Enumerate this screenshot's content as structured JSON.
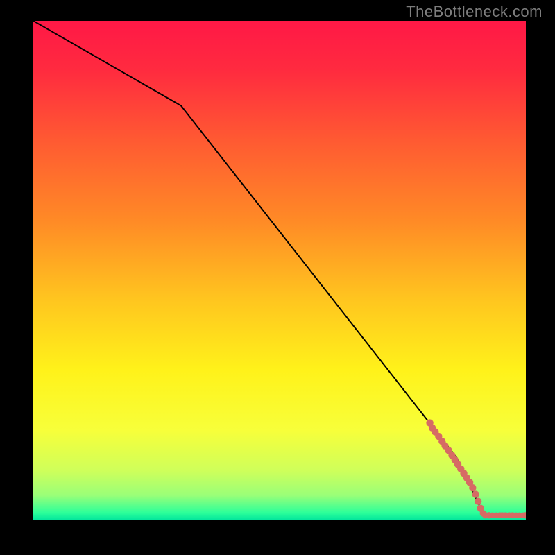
{
  "watermark": "TheBottleneck.com",
  "colors": {
    "background": "#000000",
    "gradient_stops": [
      {
        "offset": 0.0,
        "color": "#ff1846"
      },
      {
        "offset": 0.1,
        "color": "#ff2b3f"
      },
      {
        "offset": 0.24,
        "color": "#ff5a32"
      },
      {
        "offset": 0.4,
        "color": "#ff8a26"
      },
      {
        "offset": 0.56,
        "color": "#ffc61f"
      },
      {
        "offset": 0.7,
        "color": "#fff21a"
      },
      {
        "offset": 0.82,
        "color": "#f7ff3a"
      },
      {
        "offset": 0.9,
        "color": "#cfff5a"
      },
      {
        "offset": 0.95,
        "color": "#9aff78"
      },
      {
        "offset": 0.985,
        "color": "#2cff9a"
      },
      {
        "offset": 1.0,
        "color": "#00e39c"
      }
    ],
    "curve": "#000000",
    "markers": "#d66a64"
  },
  "chart_data": {
    "type": "line",
    "title": "",
    "xlabel": "",
    "ylabel": "",
    "xlim": [
      0,
      100
    ],
    "ylim": [
      0,
      100
    ],
    "grid": false,
    "series": [
      {
        "name": "curve",
        "x": [
          0,
          30,
          86,
          91.5,
          100
        ],
        "y": [
          100,
          83,
          12.5,
          1,
          1
        ]
      }
    ],
    "markers": [
      {
        "x": 80.5,
        "y": 19.5,
        "r": 1.0
      },
      {
        "x": 81.0,
        "y": 18.5,
        "r": 1.0
      },
      {
        "x": 81.6,
        "y": 17.7,
        "r": 1.0
      },
      {
        "x": 82.3,
        "y": 16.8,
        "r": 1.0
      },
      {
        "x": 83.0,
        "y": 15.8,
        "r": 1.0
      },
      {
        "x": 83.6,
        "y": 14.9,
        "r": 1.0
      },
      {
        "x": 84.3,
        "y": 14.0,
        "r": 1.0
      },
      {
        "x": 85.0,
        "y": 13.0,
        "r": 1.0
      },
      {
        "x": 85.6,
        "y": 12.1,
        "r": 1.0
      },
      {
        "x": 86.2,
        "y": 11.2,
        "r": 1.0
      },
      {
        "x": 86.8,
        "y": 10.3,
        "r": 1.0
      },
      {
        "x": 87.4,
        "y": 9.4,
        "r": 1.0
      },
      {
        "x": 88.0,
        "y": 8.5,
        "r": 1.0
      },
      {
        "x": 88.6,
        "y": 7.6,
        "r": 1.0
      },
      {
        "x": 89.2,
        "y": 6.5,
        "r": 1.0
      },
      {
        "x": 89.8,
        "y": 5.2,
        "r": 1.0
      },
      {
        "x": 90.3,
        "y": 3.8,
        "r": 1.0
      },
      {
        "x": 90.8,
        "y": 2.4,
        "r": 1.0
      },
      {
        "x": 91.3,
        "y": 1.4,
        "r": 0.9
      },
      {
        "x": 91.8,
        "y": 1.0,
        "r": 0.9
      },
      {
        "x": 92.5,
        "y": 1.0,
        "r": 0.9
      },
      {
        "x": 93.2,
        "y": 1.0,
        "r": 0.8
      },
      {
        "x": 94.0,
        "y": 1.0,
        "r": 0.8
      },
      {
        "x": 94.7,
        "y": 1.0,
        "r": 0.85
      },
      {
        "x": 95.2,
        "y": 1.0,
        "r": 0.85
      },
      {
        "x": 95.9,
        "y": 1.0,
        "r": 0.85
      },
      {
        "x": 96.6,
        "y": 1.0,
        "r": 0.85
      },
      {
        "x": 97.3,
        "y": 1.0,
        "r": 0.85
      },
      {
        "x": 98.0,
        "y": 1.0,
        "r": 0.8
      },
      {
        "x": 98.7,
        "y": 1.0,
        "r": 0.8
      },
      {
        "x": 99.4,
        "y": 1.0,
        "r": 0.8
      },
      {
        "x": 100.0,
        "y": 1.0,
        "r": 0.9
      }
    ]
  }
}
